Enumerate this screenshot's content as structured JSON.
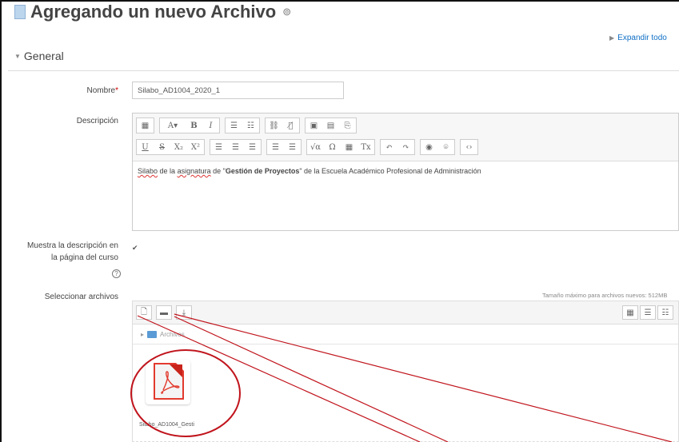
{
  "page": {
    "title": "Agregando un nuevo Archivo",
    "expand_all": "Expandir todo",
    "section": "General"
  },
  "form": {
    "name_label": "Nombre",
    "name_required": "*",
    "name_value": "Silabo_AD1004_2020_1",
    "description_label": "Descripción",
    "description_text": {
      "p1": "Silabo",
      "p2": " de la ",
      "p3": "asignatura",
      "p4": " de \"",
      "p5": "Gestión de Proyectos",
      "p6": "\" de la Escuela Académico Profesional de Administración"
    },
    "show_desc_label_1": "Muestra la descripción en",
    "show_desc_label_2": "la página del curso",
    "show_desc_checked": "✔",
    "select_files_label": "Seleccionar archivos",
    "max_size": "Tamaño máximo para archivos nuevos: 512MB"
  },
  "editor_toolbar": {
    "row1": [
      "▦",
      "A▾",
      "B",
      "I",
      "☰",
      "☷",
      "⛓",
      "⛓̸",
      "▣",
      "▤",
      "⎘"
    ],
    "row2": [
      "U",
      "S",
      "X₂",
      "X²",
      "☰",
      "☰",
      "☰",
      "☰",
      "☰",
      "√α",
      "Ω",
      "▦",
      "Tx",
      "↶",
      "↷",
      "◉",
      "⌾",
      "‹›"
    ]
  },
  "filepicker": {
    "path_label": "Archivos",
    "file_name": "Silabo_AD1004_Gesti",
    "buttons": [
      "add-file-icon",
      "create-folder-icon",
      "download-icon"
    ]
  },
  "colors": {
    "accent_link": "#0f6fc5",
    "required": "#cc0000",
    "annotation": "#c0141c"
  }
}
